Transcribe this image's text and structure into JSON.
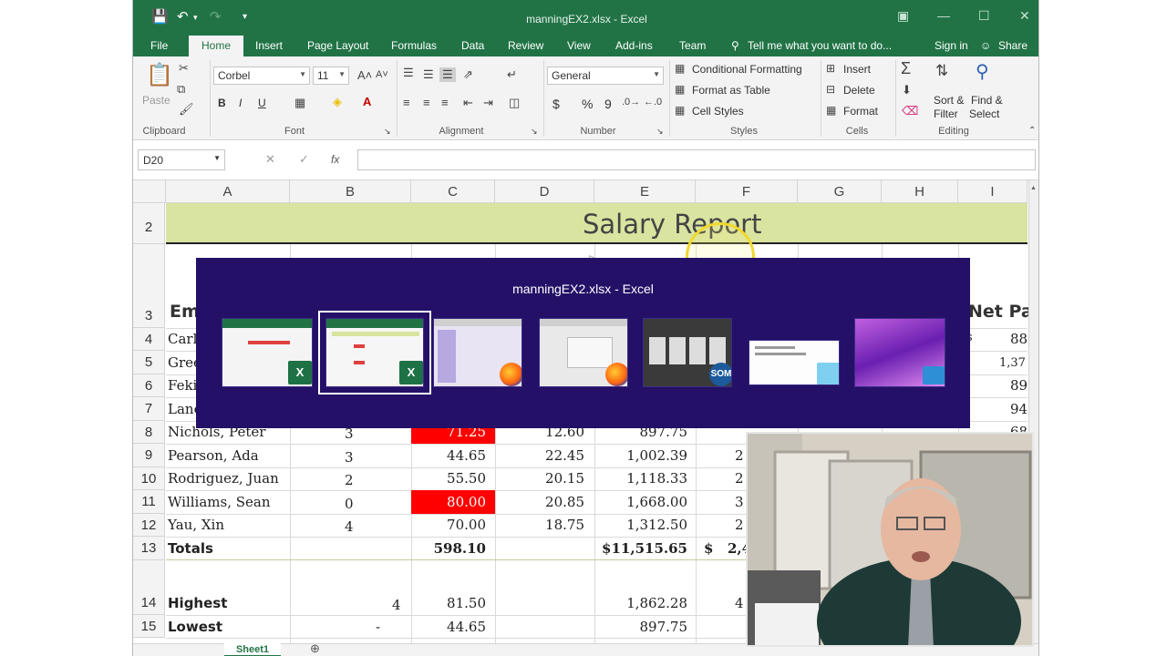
{
  "window": {
    "title": "manningEX2.xlsx - Excel"
  },
  "ribbon_tabs": [
    "File",
    "Home",
    "Insert",
    "Page Layout",
    "Formulas",
    "Data",
    "Review",
    "View",
    "Add-ins",
    "Team"
  ],
  "tell_me": "Tell me what you want to do...",
  "sign_in": "Sign in",
  "share": "Share",
  "clipboard": {
    "paste": "Paste",
    "label": "Clipboard"
  },
  "font": {
    "name": "Corbel",
    "size": "11",
    "bold": "B",
    "italic": "I",
    "underline": "U",
    "label": "Font"
  },
  "alignment": {
    "label": "Alignment"
  },
  "number": {
    "format": "General",
    "currency": "$",
    "percent": "%",
    "comma": "9",
    "label": "Number"
  },
  "styles": {
    "conditional": "Conditional Formatting",
    "format_table": "Format as Table",
    "cell_styles": "Cell Styles",
    "label": "Styles"
  },
  "cells": {
    "insert": "Insert",
    "delete": "Delete",
    "format": "Format",
    "label": "Cells"
  },
  "editing": {
    "sort": "Sort &",
    "filter": "Filter",
    "find": "Find &",
    "select": "Select",
    "label": "Editing"
  },
  "formula_bar": {
    "name_box": "D20",
    "fx": "fx",
    "value": ""
  },
  "columns": [
    "A",
    "B",
    "C",
    "D",
    "E",
    "F",
    "G",
    "H",
    "I"
  ],
  "sheet": {
    "title": "Salary Report",
    "header_row": {
      "row": "3",
      "a": "Em",
      "i": "Net Pay"
    },
    "rows": [
      {
        "row": "2",
        "a": "",
        "b": "",
        "c": "",
        "d": "",
        "e": ""
      },
      {
        "row": "4",
        "a": "Carl,",
        "b": "",
        "c": "",
        "d": "",
        "e": "",
        "h": "s",
        "i": "88"
      },
      {
        "row": "5",
        "a": "Gree",
        "b": "",
        "c": "",
        "d": "",
        "e": "",
        "i": "1,37"
      },
      {
        "row": "6",
        "a": "Feki",
        "b": "",
        "c": "",
        "d": "",
        "e": "",
        "i": "89"
      },
      {
        "row": "7",
        "a": "Lane",
        "b": "",
        "c": "",
        "d": "",
        "e": "",
        "i": "94"
      },
      {
        "row": "8",
        "a": "Nichols, Peter",
        "b": "3",
        "c": "71.25",
        "d": "12.60",
        "e": "897.75",
        "i": "68"
      },
      {
        "row": "9",
        "a": "Pearson, Ada",
        "b": "3",
        "c": "44.65",
        "d": "22.45",
        "e": "1,002.39",
        "f": "2"
      },
      {
        "row": "10",
        "a": "Rodriguez, Juan",
        "b": "2",
        "c": "55.50",
        "d": "20.15",
        "e": "1,118.33",
        "f": "2"
      },
      {
        "row": "11",
        "a": "Williams, Sean",
        "b": "0",
        "c": "80.00",
        "d": "20.85",
        "e": "1,668.00",
        "f": "3"
      },
      {
        "row": "12",
        "a": "Yau, Xin",
        "b": "4",
        "c": "70.00",
        "d": "18.75",
        "e": "1,312.50",
        "f": "2"
      },
      {
        "row": "13",
        "a": "Totals",
        "b": "",
        "c": "598.10",
        "d": "",
        "e_cur": "$",
        "e": "11,515.65",
        "f_cur": "$",
        "f": "2,4"
      },
      {
        "row": "14",
        "a": "Highest",
        "b": "4",
        "c": "81.50",
        "d": "",
        "e": "1,862.28",
        "f": "4"
      },
      {
        "row": "15",
        "a": "Lowest",
        "b": "-",
        "c": "44.65",
        "d": "",
        "e": "897.75",
        "f": ""
      }
    ]
  },
  "switcher": {
    "title": "manningEX2.xlsx - Excel",
    "items": [
      {
        "app": "Excel",
        "badge": "X",
        "icon": "excel-icon"
      },
      {
        "app": "Excel",
        "badge": "X",
        "icon": "excel-icon",
        "selected": true
      },
      {
        "app": "Firefox",
        "badge": "",
        "icon": "firefox-icon"
      },
      {
        "app": "Firefox",
        "badge": "",
        "icon": "firefox-icon"
      },
      {
        "app": "SOM",
        "badge": "SOM",
        "icon": "som-icon"
      },
      {
        "app": "Notepad",
        "badge": "",
        "icon": "notepad-icon"
      },
      {
        "app": "Photos",
        "badge": "",
        "icon": "image-icon"
      }
    ]
  },
  "sheet_tab": "Sheet1",
  "colors": {
    "excel_green": "#217346",
    "highlight_red": "#ff0000",
    "banner": "#d8e4a0",
    "switcher_bg": "#241167"
  }
}
